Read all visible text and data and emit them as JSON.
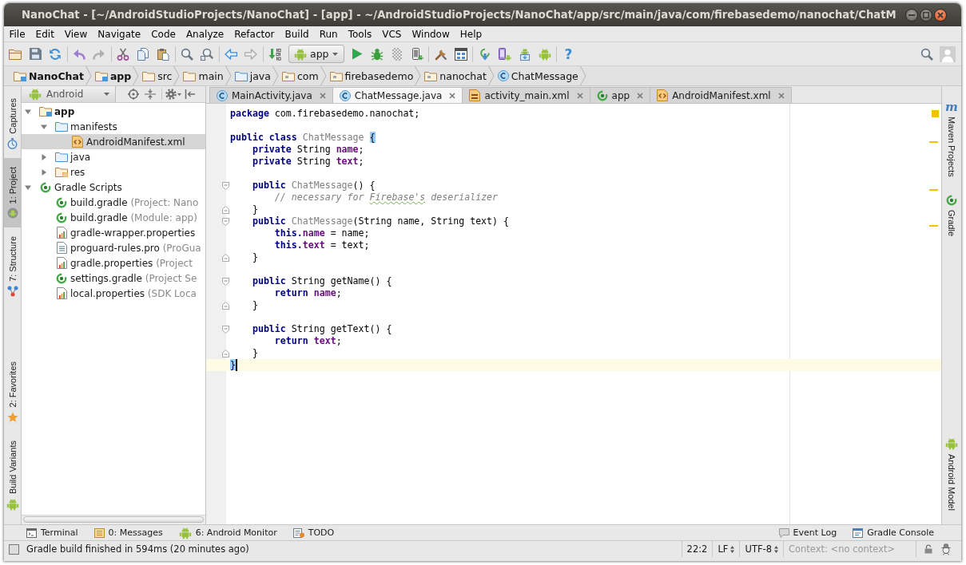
{
  "window": {
    "title": "NanoChat - [~/AndroidStudioProjects/NanoChat] - [app] - ~/AndroidStudioProjects/NanoChat/app/src/main/java/com/firebasedemo/nanochat/ChatM"
  },
  "menu": [
    "File",
    "Edit",
    "View",
    "Navigate",
    "Code",
    "Analyze",
    "Refactor",
    "Build",
    "Run",
    "Tools",
    "VCS",
    "Window",
    "Help"
  ],
  "toolbar": {
    "groups": [
      [
        {
          "kind": "open",
          "disabled": false
        },
        {
          "kind": "save",
          "disabled": false
        },
        {
          "kind": "sync",
          "disabled": false
        }
      ],
      [
        {
          "kind": "undo",
          "disabled": false
        },
        {
          "kind": "redo",
          "disabled": true
        }
      ],
      [
        {
          "kind": "cut",
          "disabled": false
        },
        {
          "kind": "copy",
          "disabled": false
        },
        {
          "kind": "paste",
          "disabled": false
        }
      ],
      [
        {
          "kind": "find",
          "disabled": false
        },
        {
          "kind": "replace",
          "disabled": false
        }
      ],
      [
        {
          "kind": "back",
          "disabled": false
        },
        {
          "kind": "forward",
          "disabled": true
        }
      ],
      [
        {
          "kind": "make",
          "disabled": false
        },
        {
          "kind": "run-config",
          "label": "app",
          "disabled": false
        },
        {
          "kind": "run",
          "disabled": false
        },
        {
          "kind": "debug",
          "disabled": false
        },
        {
          "kind": "attach",
          "disabled": true
        },
        {
          "kind": "device",
          "disabled": false
        }
      ],
      [
        {
          "kind": "sdk-tools",
          "disabled": false
        },
        {
          "kind": "structure",
          "disabled": false
        }
      ],
      [
        {
          "kind": "gradle-sync",
          "disabled": false
        },
        {
          "kind": "avd",
          "disabled": false
        },
        {
          "kind": "sdk-manager",
          "disabled": false
        },
        {
          "kind": "android",
          "disabled": false
        }
      ],
      [
        {
          "kind": "help",
          "label": "?",
          "disabled": false
        }
      ]
    ],
    "right": [
      {
        "kind": "search",
        "disabled": false
      },
      {
        "kind": "user"
      }
    ]
  },
  "navigation": [
    {
      "label": "NanoChat",
      "kind": "project"
    },
    {
      "label": "app",
      "kind": "module"
    },
    {
      "label": "src",
      "kind": "folder"
    },
    {
      "label": "main",
      "kind": "folder"
    },
    {
      "label": "java",
      "kind": "source-folder"
    },
    {
      "label": "com",
      "kind": "package"
    },
    {
      "label": "firebasedemo",
      "kind": "package"
    },
    {
      "label": "nanochat",
      "kind": "package"
    },
    {
      "label": "ChatMessage",
      "kind": "class"
    }
  ],
  "left_stripe": {
    "top": [
      {
        "label": "Captures",
        "kind": "captures",
        "selected": false
      },
      {
        "label": "1: Project",
        "kind": "project",
        "selected": true
      },
      {
        "label": "7: Structure",
        "kind": "structure",
        "selected": false
      }
    ],
    "bottom": [
      {
        "label": "2: Favorites",
        "kind": "favorites",
        "selected": false
      },
      {
        "label": "Build Variants",
        "kind": "android",
        "selected": false
      }
    ]
  },
  "project": {
    "view": "Android",
    "tools": [
      {
        "kind": "locate"
      },
      {
        "kind": "collapse"
      },
      {
        "kind": "settings"
      },
      {
        "kind": "hide"
      }
    ],
    "tree": [
      {
        "name": "app",
        "kind": "module",
        "expanded": true,
        "selected": false,
        "children": [
          {
            "name": "manifests",
            "kind": "source-folder",
            "expanded": true,
            "selected": false,
            "children": [
              {
                "name": "AndroidManifest.xml",
                "kind": "xml",
                "selected": true
              }
            ]
          },
          {
            "name": "java",
            "kind": "source-folder",
            "expanded": false,
            "selected": false
          },
          {
            "name": "res",
            "kind": "res-folder",
            "expanded": false,
            "selected": false
          }
        ]
      },
      {
        "name": "Gradle Scripts",
        "kind": "gradle",
        "expanded": true,
        "selected": false,
        "children": [
          {
            "name": "build.gradle",
            "hint": "(Project: Nano",
            "kind": "gradle",
            "selected": false
          },
          {
            "name": "build.gradle",
            "hint": "(Module: app)",
            "kind": "gradle",
            "selected": false
          },
          {
            "name": "gradle-wrapper.properties",
            "kind": "properties",
            "selected": false
          },
          {
            "name": "proguard-rules.pro",
            "hint": "(ProGua",
            "kind": "text",
            "selected": false
          },
          {
            "name": "gradle.properties",
            "hint": "(Project",
            "kind": "properties",
            "selected": false
          },
          {
            "name": "settings.gradle",
            "hint": "(Project Se",
            "kind": "gradle",
            "selected": false
          },
          {
            "name": "local.properties",
            "hint": "(SDK Loca",
            "kind": "properties",
            "selected": false
          }
        ]
      }
    ]
  },
  "editor": {
    "tabs": [
      {
        "label": "MainActivity.java",
        "kind": "class",
        "selected": false
      },
      {
        "label": "ChatMessage.java",
        "kind": "class",
        "selected": true
      },
      {
        "label": "activity_main.xml",
        "kind": "layout-xml",
        "selected": false
      },
      {
        "label": "app",
        "kind": "gradle",
        "selected": false
      },
      {
        "label": "AndroidManifest.xml",
        "kind": "xml",
        "selected": false
      }
    ],
    "warnings": true,
    "blocks": [
      [
        {
          "tokens": [
            {
              "kind": "keyword",
              "text": "package "
            },
            {
              "kind": "plain",
              "text": "com.firebasedemo.nanochat;"
            }
          ]
        }
      ],
      [
        {
          "warning": true,
          "tokens": [
            {
              "kind": "keyword",
              "text": "public class "
            },
            {
              "kind": "unused",
              "text": "ChatMessage "
            },
            {
              "kind": "brace-match",
              "text": "{"
            }
          ]
        },
        {
          "tokens": [
            {
              "kind": "keyword",
              "text": "    private "
            },
            {
              "kind": "plain",
              "text": "String "
            },
            {
              "kind": "field",
              "text": "name"
            },
            {
              "kind": "plain",
              "text": ";"
            }
          ]
        },
        {
          "tokens": [
            {
              "kind": "keyword",
              "text": "    private "
            },
            {
              "kind": "plain",
              "text": "String "
            },
            {
              "kind": "field",
              "text": "text"
            },
            {
              "kind": "plain",
              "text": ";"
            }
          ]
        }
      ],
      [
        {
          "fold_start": true,
          "warning": true,
          "tokens": [
            {
              "kind": "keyword",
              "text": "    public "
            },
            {
              "kind": "unused",
              "text": "ChatMessage"
            },
            {
              "kind": "plain",
              "text": "() {"
            }
          ]
        },
        {
          "tokens": [
            {
              "kind": "comment",
              "text": "        // necessary for "
            },
            {
              "kind": "comment",
              "text": "Firebase's",
              "typo": true
            },
            {
              "kind": "comment",
              "text": " deserializer"
            }
          ]
        },
        {
          "fold_end": true,
          "tokens": [
            {
              "kind": "plain",
              "text": "    }"
            }
          ]
        },
        {
          "fold_start": true,
          "warning": true,
          "tokens": [
            {
              "kind": "keyword",
              "text": "    public "
            },
            {
              "kind": "unused",
              "text": "ChatMessage"
            },
            {
              "kind": "plain",
              "text": "(String name, String text) {"
            }
          ]
        },
        {
          "tokens": [
            {
              "kind": "keyword",
              "text": "        this."
            },
            {
              "kind": "field",
              "text": "name"
            },
            {
              "kind": "plain",
              "text": " = name;"
            }
          ]
        },
        {
          "tokens": [
            {
              "kind": "keyword",
              "text": "        this."
            },
            {
              "kind": "field",
              "text": "text"
            },
            {
              "kind": "plain",
              "text": " = text;"
            }
          ]
        },
        {
          "fold_end": true,
          "tokens": [
            {
              "kind": "plain",
              "text": "    }"
            }
          ]
        }
      ],
      [
        {
          "fold_start": true,
          "tokens": [
            {
              "kind": "keyword",
              "text": "    public "
            },
            {
              "kind": "plain",
              "text": "String getName() {"
            }
          ]
        },
        {
          "tokens": [
            {
              "kind": "keyword",
              "text": "        return "
            },
            {
              "kind": "field",
              "text": "name"
            },
            {
              "kind": "plain",
              "text": ";"
            }
          ]
        },
        {
          "fold_end": true,
          "tokens": [
            {
              "kind": "plain",
              "text": "    }"
            }
          ]
        }
      ],
      [
        {
          "fold_start": true,
          "tokens": [
            {
              "kind": "keyword",
              "text": "    public "
            },
            {
              "kind": "plain",
              "text": "String getText() {"
            }
          ]
        },
        {
          "tokens": [
            {
              "kind": "keyword",
              "text": "        return "
            },
            {
              "kind": "field",
              "text": "text"
            },
            {
              "kind": "plain",
              "text": ";"
            }
          ]
        },
        {
          "fold_end": true,
          "tokens": [
            {
              "kind": "plain",
              "text": "    }"
            }
          ]
        },
        {
          "current": true,
          "caret": true,
          "tokens": [
            {
              "kind": "brace-match",
              "text": "}"
            }
          ]
        }
      ]
    ]
  },
  "right_stripe": {
    "top": [
      {
        "label": "Maven Projects",
        "kind": "maven",
        "glyph": "m",
        "selected": false
      },
      {
        "label": "Gradle",
        "kind": "gradle",
        "selected": false
      }
    ],
    "bottom": [
      {
        "label": "Android Model",
        "kind": "android",
        "selected": false
      }
    ]
  },
  "tool_windows": {
    "left": [
      {
        "label": "Terminal",
        "kind": "terminal",
        "selected": false
      },
      {
        "label": "0: Messages",
        "kind": "messages",
        "selected": false
      },
      {
        "label": "6: Android Monitor",
        "kind": "android",
        "selected": false
      },
      {
        "label": "TODO",
        "kind": "todo",
        "selected": false
      }
    ],
    "right": [
      {
        "label": "Event Log",
        "kind": "event-log",
        "selected": false
      },
      {
        "label": "Gradle Console",
        "kind": "console",
        "selected": false
      }
    ]
  },
  "status_bar": {
    "message": "Gradle build finished in 594ms (20 minutes ago)",
    "position": "22:2",
    "line_separator": "LF",
    "encoding": "UTF-8",
    "context": "Context: <no context>"
  }
}
